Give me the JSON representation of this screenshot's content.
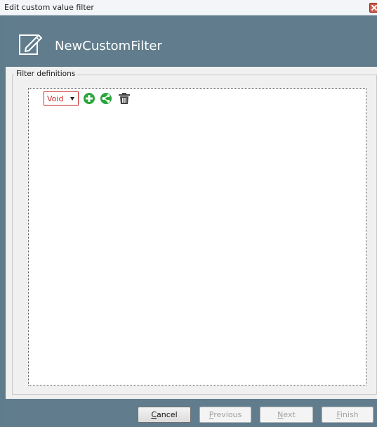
{
  "window": {
    "title": "Edit custom value filter"
  },
  "header": {
    "filter_name": "NewCustomFilter"
  },
  "group": {
    "legend": "Filter definitions"
  },
  "filter_row": {
    "combo_value": "Void",
    "icons": [
      "add-icon",
      "share-icon",
      "trash-icon"
    ]
  },
  "buttons": {
    "cancel": {
      "mnemonic": "C",
      "rest": "ancel"
    },
    "previous": {
      "mnemonic": "P",
      "rest": "revious"
    },
    "next": {
      "mnemonic": "N",
      "rest": "ext"
    },
    "finish": {
      "mnemonic": "F",
      "rest": "inish"
    }
  },
  "colors": {
    "accent": "#617d8d",
    "combo_border": "#cc2a2a",
    "icon_green": "#2aa63a"
  }
}
